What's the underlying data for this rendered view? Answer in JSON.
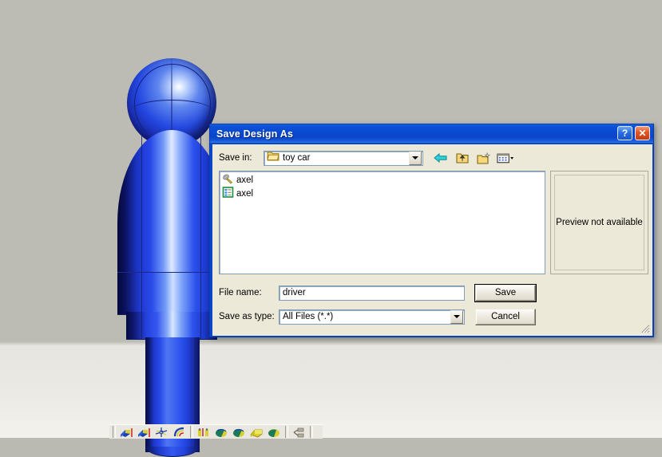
{
  "app": {
    "background_color": "#bcbcb5",
    "viewport_name": "cad-3d-viewport",
    "model_name": "driver figure"
  },
  "cad_toolbar": {
    "name": "bottom-cad-toolbar",
    "icons": [
      "extrude-boss-icon",
      "extrude-cut-icon",
      "axis-icon",
      "fillet-icon",
      "reference-geometry-icon",
      "revolve-boss-icon",
      "revolve-cut-icon",
      "shell-icon",
      "draft-icon",
      "pattern-icon"
    ]
  },
  "dialog": {
    "title": "Save Design As",
    "help_button": "?",
    "close_button": "✕",
    "save_in": {
      "label": "Save in:",
      "value": "toy car",
      "folder_icon": "folder-icon",
      "dropdown_icon": "chevron-down-icon"
    },
    "toolbar": [
      {
        "name": "back-button",
        "icon": "back-arrow-icon"
      },
      {
        "name": "up-one-level-button",
        "icon": "up-folder-icon"
      },
      {
        "name": "new-folder-button",
        "icon": "new-folder-icon"
      },
      {
        "name": "views-button",
        "icon": "views-menu-icon"
      }
    ],
    "file_list": [
      {
        "name": "axel",
        "icon": "part-file-icon"
      },
      {
        "name": "axel",
        "icon": "document-file-icon"
      }
    ],
    "preview": {
      "text": "Preview not available"
    },
    "file_name": {
      "label": "File name:",
      "value": "driver",
      "placeholder": ""
    },
    "save_as_type": {
      "label": "Save as type:",
      "value": "All Files (*.*)",
      "options": [
        "All Files (*.*)"
      ]
    },
    "buttons": {
      "save": "Save",
      "cancel": "Cancel"
    },
    "colors": {
      "titlebar": "#0a49d2",
      "face": "#ece9d8",
      "field": "#ffffff",
      "field_border": "#7f9db9"
    }
  }
}
